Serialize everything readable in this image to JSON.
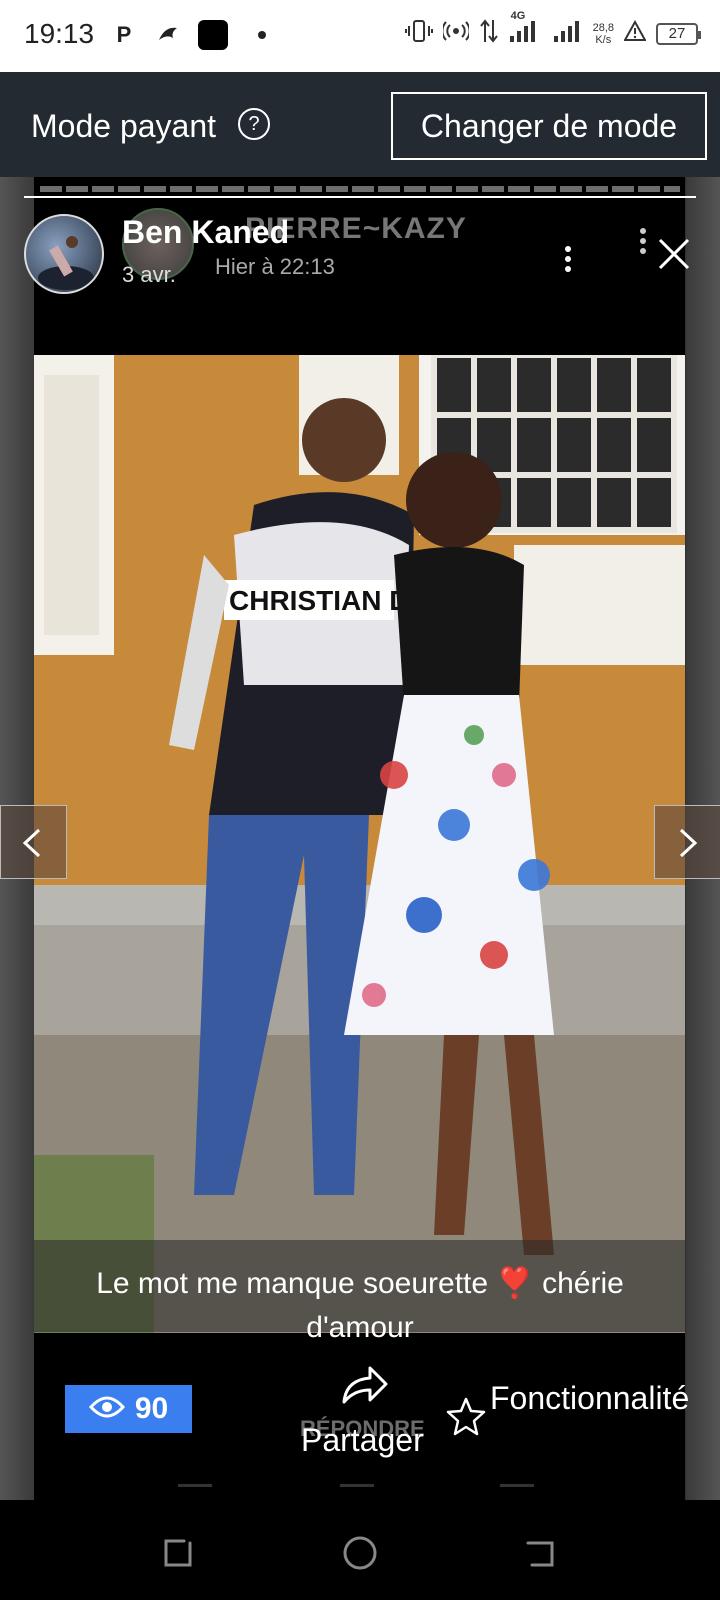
{
  "status_bar": {
    "time": "19:13",
    "network": "4G",
    "speed_value": "28,8",
    "speed_unit": "K/s",
    "battery": "27"
  },
  "header": {
    "title": "Mode payant",
    "help_icon": "?",
    "change_mode_label": "Changer de mode"
  },
  "story": {
    "author_name": "Ben Kaned",
    "post_date": "3 avr.",
    "ghost_author": "PIERRE~KAZY",
    "ghost_time": "Hier à 22:13",
    "caption": "Le mot me manque soeurette ❣️ chérie d'amour"
  },
  "actions": {
    "views_count": "90",
    "reply_ghost": "RÉPONDRE",
    "share_label": "Partager",
    "feature_label": "Fonctionnalité"
  },
  "colors": {
    "header_bg": "#242a31",
    "views_badge": "#3a7ef0"
  }
}
